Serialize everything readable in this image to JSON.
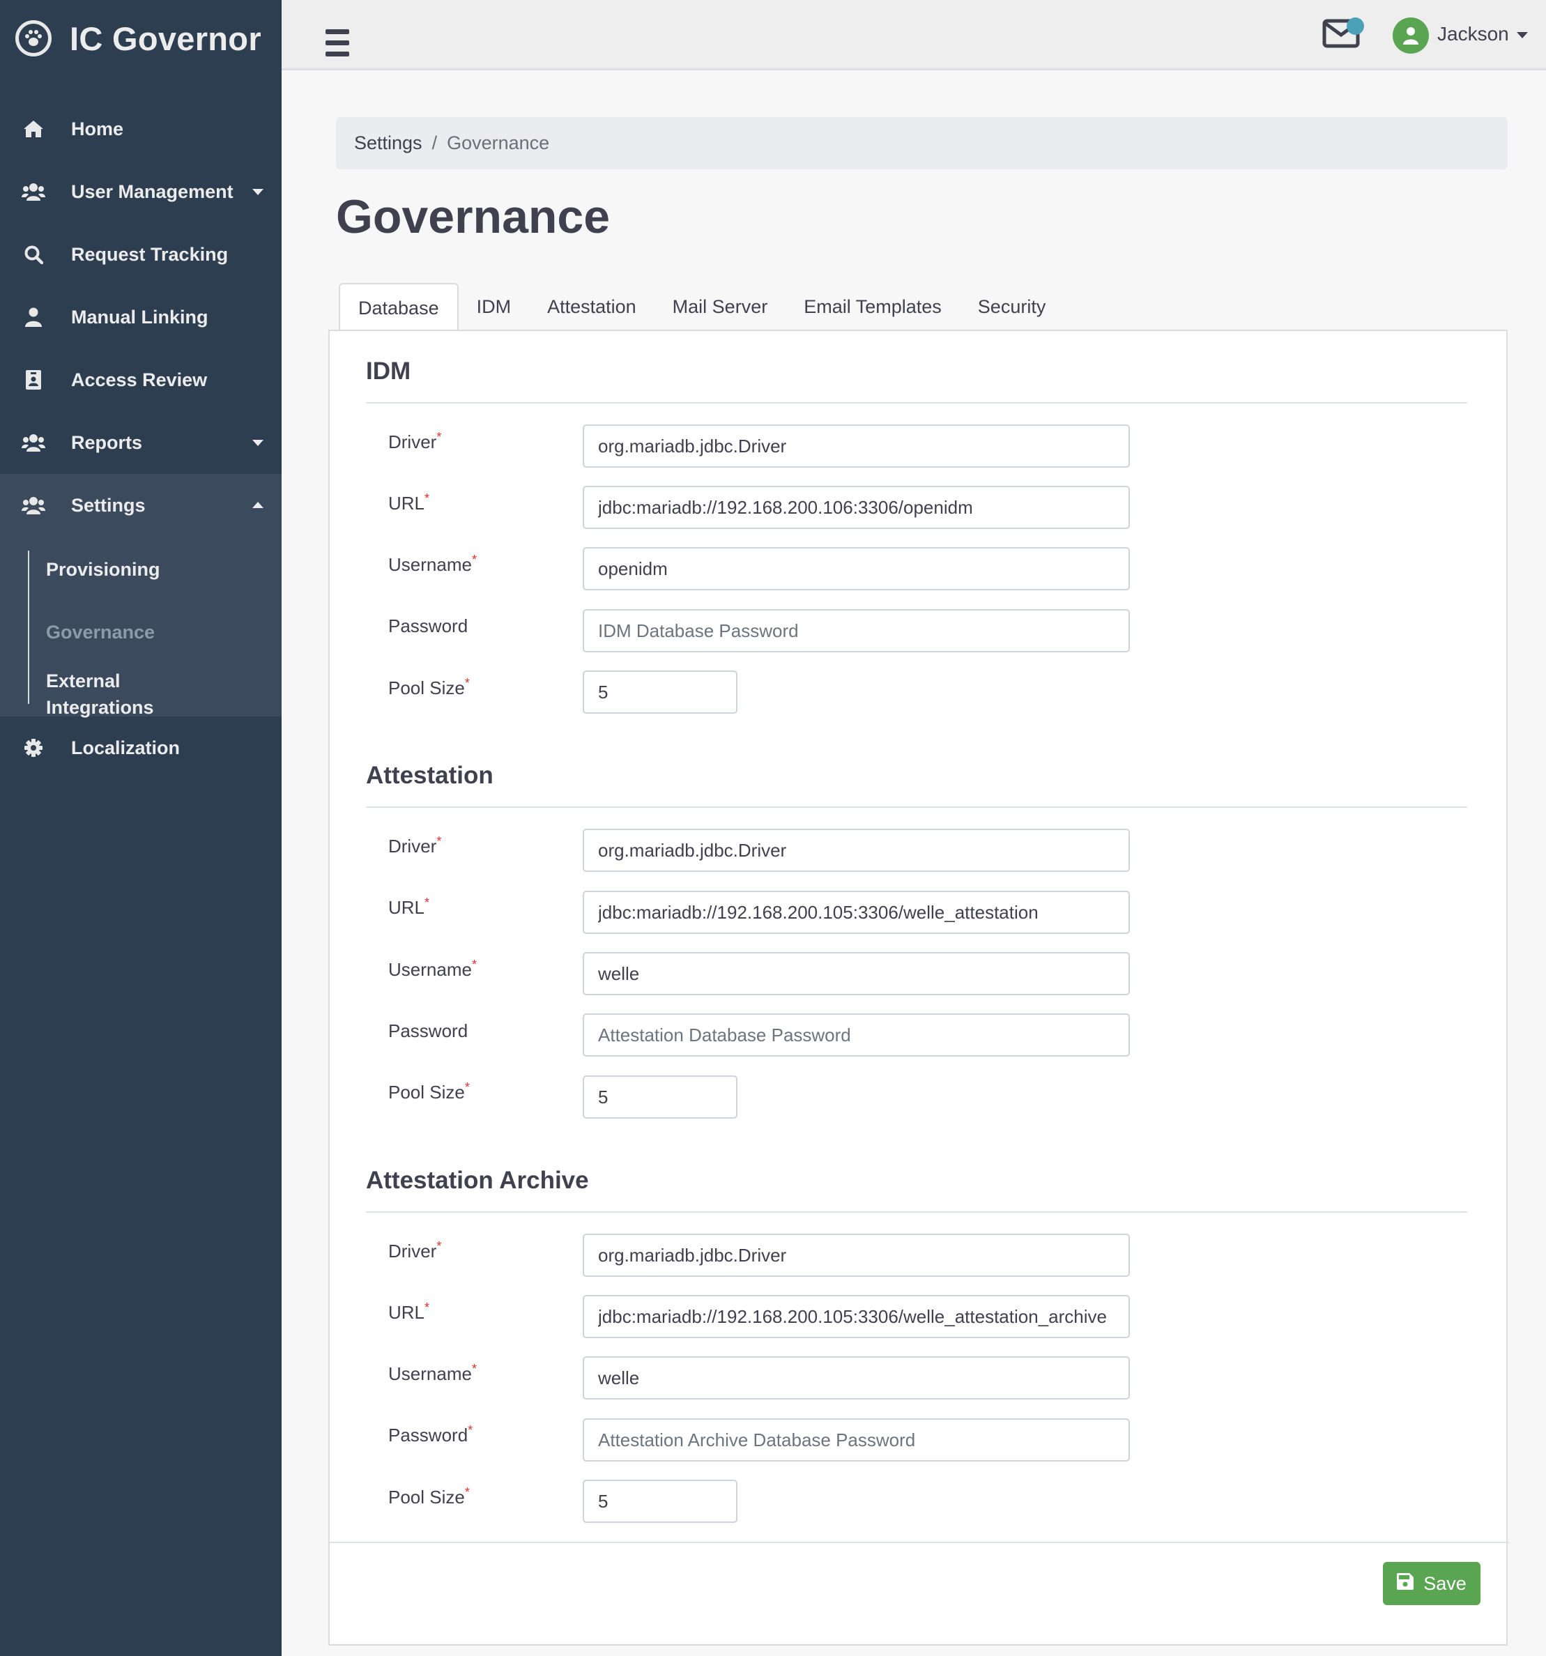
{
  "app": {
    "title": "IC Governor",
    "logo_icon": "paw-icon"
  },
  "sidebar": {
    "items": [
      {
        "label": "Home",
        "icon": "home-icon"
      },
      {
        "label": "User Management",
        "icon": "users-icon",
        "expandable": true
      },
      {
        "label": "Request Tracking",
        "icon": "search-icon"
      },
      {
        "label": "Manual Linking",
        "icon": "user-icon"
      },
      {
        "label": "Access Review",
        "icon": "id-badge-icon"
      },
      {
        "label": "Reports",
        "icon": "users-icon",
        "expandable": true
      },
      {
        "label": "Settings",
        "icon": "users-icon",
        "expanded": true
      },
      {
        "label": "Localization",
        "icon": "gear-icon"
      }
    ],
    "settings_children": [
      {
        "label": "Provisioning",
        "active": false
      },
      {
        "label": "Governance",
        "active": true
      },
      {
        "label": "External Integrations",
        "active": false
      }
    ]
  },
  "topbar": {
    "menu_icon": "hamburger-icon",
    "mail_icon": "envelope-icon",
    "user_name": "Jackson"
  },
  "breadcrumb": {
    "parent": "Settings",
    "separator": "/",
    "current": "Governance"
  },
  "page": {
    "title": "Governance"
  },
  "tabs": [
    {
      "label": "Database",
      "active": true
    },
    {
      "label": "IDM",
      "active": false
    },
    {
      "label": "Attestation",
      "active": false
    },
    {
      "label": "Mail Server",
      "active": false
    },
    {
      "label": "Email Templates",
      "active": false
    },
    {
      "label": "Security",
      "active": false
    }
  ],
  "sections": [
    {
      "title": "IDM",
      "fields": [
        {
          "label": "Driver",
          "required": true,
          "value": "org.mariadb.jdbc.Driver",
          "placeholder": ""
        },
        {
          "label": "URL",
          "required": true,
          "value": "jdbc:mariadb://192.168.200.106:3306/openidm",
          "placeholder": ""
        },
        {
          "label": "Username",
          "required": true,
          "value": "openidm",
          "placeholder": ""
        },
        {
          "label": "Password",
          "required": false,
          "value": "",
          "placeholder": "IDM Database Password"
        },
        {
          "label": "Pool Size",
          "required": true,
          "value": "5",
          "placeholder": ""
        }
      ]
    },
    {
      "title": "Attestation",
      "fields": [
        {
          "label": "Driver",
          "required": true,
          "value": "org.mariadb.jdbc.Driver",
          "placeholder": ""
        },
        {
          "label": "URL",
          "required": true,
          "value": "jdbc:mariadb://192.168.200.105:3306/welle_attestation",
          "placeholder": ""
        },
        {
          "label": "Username",
          "required": true,
          "value": "welle",
          "placeholder": ""
        },
        {
          "label": "Password",
          "required": false,
          "value": "",
          "placeholder": "Attestation Database Password"
        },
        {
          "label": "Pool Size",
          "required": true,
          "value": "5",
          "placeholder": ""
        }
      ]
    },
    {
      "title": "Attestation Archive",
      "fields": [
        {
          "label": "Driver",
          "required": true,
          "value": "org.mariadb.jdbc.Driver",
          "placeholder": ""
        },
        {
          "label": "URL",
          "required": true,
          "value": "jdbc:mariadb://192.168.200.105:3306/welle_attestation_archive",
          "placeholder": ""
        },
        {
          "label": "Username",
          "required": true,
          "value": "welle",
          "placeholder": ""
        },
        {
          "label": "Password",
          "required": true,
          "value": "",
          "placeholder": "Attestation Archive Database Password"
        },
        {
          "label": "Pool Size",
          "required": true,
          "value": "5",
          "placeholder": ""
        }
      ]
    }
  ],
  "actions": {
    "save_label": "Save",
    "save_icon": "floppy-disk-icon"
  },
  "colors": {
    "sidebar": "#2e3e51",
    "sidebar_group": "#3b4a5d",
    "save": "#59a552",
    "required": "#e0302f",
    "notification_dot": "#4ba1b7",
    "avatar": "#59a552"
  }
}
